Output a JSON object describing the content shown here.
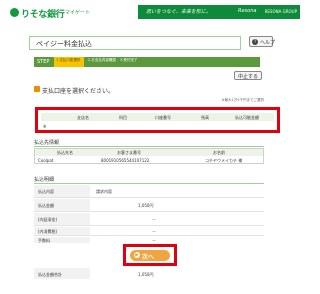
{
  "header": {
    "logo": "りそな銀行",
    "logo_sub": "マイゲート",
    "banner_text": "思いをつなぐ、未来を形に。",
    "banner_logo": "Resona",
    "banner_group": "RESONA GROUP",
    "help": "ヘルプ"
  },
  "page": {
    "title": "ペイジー料金払込",
    "stop_button": "中止する",
    "select_prompt": "支払口座を選択ください。",
    "note": "※最大1万5千円までご選択"
  },
  "steps": {
    "label": "STEP",
    "items": [
      "1.支払口座選択",
      "2.お支払内容確認",
      "3.受付完了"
    ]
  },
  "account_table": {
    "headers": [
      "支店名",
      "科目",
      "口座番号",
      "残高",
      "払込可能金額"
    ],
    "row_label": "※"
  },
  "destination": {
    "title": "払込先情報",
    "headers": [
      "払込先名",
      "お客さま番号",
      "お名前"
    ],
    "row": [
      "Coolpat",
      "8001910565544107122",
      "コチヤウメイカチ 様"
    ]
  },
  "details": {
    "title": "払込明細",
    "rows": [
      {
        "label": "払込内容",
        "value": "請求内容"
      },
      {
        "label": "払込金額",
        "value": "1,050円"
      },
      {
        "label": "(内延滞金)",
        "value": "－"
      },
      {
        "label": "(内消費税)",
        "value": "－"
      },
      {
        "label": "手数料",
        "value": "－"
      }
    ],
    "total_label": "払込金額合計",
    "total_value": "1,050円"
  },
  "next_button": "次へ",
  "colors": {
    "brand_green": "#139a3e",
    "step_green": "#5a9a3c",
    "step_active": "#f7c400",
    "highlight_red": "#e1000f",
    "next_orange": "#f0a640"
  }
}
